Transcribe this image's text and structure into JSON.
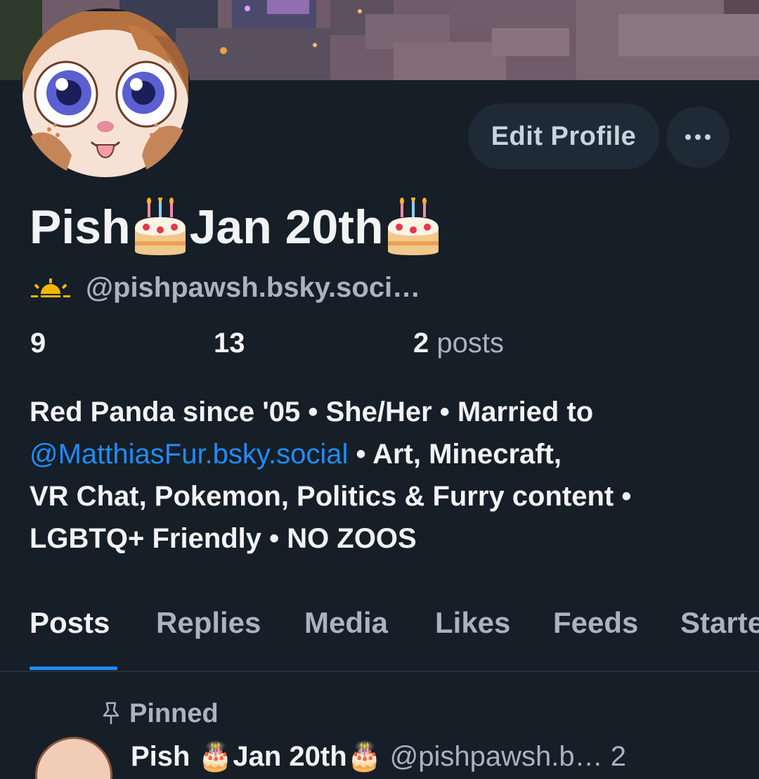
{
  "profile": {
    "display_name": "Pish 🎂Jan 20th🎂",
    "name_part_1": "Pish ",
    "name_part_2": "Jan 20th",
    "handle_emoji": "sunrise-icon",
    "handle": "@pishpawsh.bsky.soci…"
  },
  "actions": {
    "edit_profile_label": "Edit Profile",
    "more_label": "···"
  },
  "stats": {
    "followers_count": "9",
    "following_count": "13",
    "posts_count": "2",
    "posts_label": "posts"
  },
  "bio": {
    "line1": "Red Panda since '05 • She/Her • Married to",
    "mention": "@MatthiasFur.bsky.social",
    "line2_rest": " • Art, Minecraft,",
    "line3": "VR Chat, Pokemon, Politics & Furry content •",
    "line4": "LGBTQ+ Friendly • NO ZOOS"
  },
  "tabs": [
    {
      "label": "Posts",
      "active": true
    },
    {
      "label": "Replies",
      "active": false
    },
    {
      "label": "Media",
      "active": false
    },
    {
      "label": "Likes",
      "active": false
    },
    {
      "label": "Feeds",
      "active": false
    },
    {
      "label": "Starter Packs",
      "active": false
    }
  ],
  "feed": {
    "pinned_label": "Pinned",
    "first_post": {
      "author_name": "Pish 🎂Jan 20th🎂",
      "author_handle": "@pishpawsh.b…",
      "timestamp": "2"
    }
  },
  "colors": {
    "background": "#161e27",
    "accent": "#208bfe",
    "muted_text": "#a9b4c0",
    "button_bg": "#1e2a36"
  }
}
